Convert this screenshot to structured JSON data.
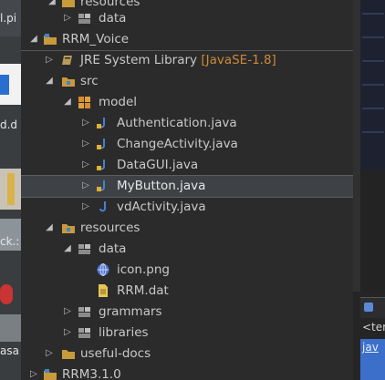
{
  "desktop": {
    "snippets": [
      "l.pi",
      "d.d",
      "ck.:",
      "asa"
    ]
  },
  "tree": {
    "rows": [
      {
        "label": "resources"
      },
      {
        "label": "data"
      },
      {
        "label": "RRM_Voice"
      },
      {
        "label": "JRE System Library",
        "decoration": "[JavaSE-1.8]"
      },
      {
        "label": "src"
      },
      {
        "label": "model"
      },
      {
        "label": "Authentication.java"
      },
      {
        "label": "ChangeActivity.java"
      },
      {
        "label": "DataGUI.java"
      },
      {
        "label": "MyButton.java"
      },
      {
        "label": "vdActivity.java"
      },
      {
        "label": "resources"
      },
      {
        "label": "data"
      },
      {
        "label": "icon.png"
      },
      {
        "label": "RRM.dat"
      },
      {
        "label": "grammars"
      },
      {
        "label": "libraries"
      },
      {
        "label": "useful-docs"
      },
      {
        "label": "RRM3.1.0"
      }
    ]
  },
  "console": {
    "line1": "<ter",
    "line2": "jav"
  }
}
